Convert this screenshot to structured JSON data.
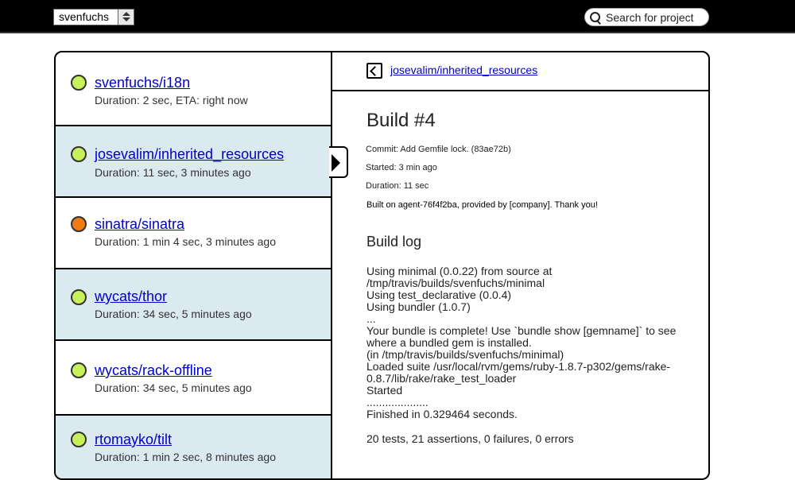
{
  "topbar": {
    "user_select_value": "svenfuchs",
    "search_placeholder": "Search for project"
  },
  "repos": [
    {
      "name": "svenfuchs/i18n",
      "meta": "Duration: 2 sec, ETA: right now",
      "status": "passing",
      "status_color": "#c8f05a"
    },
    {
      "name": "josevalim/inherited_resources",
      "meta": "Duration: 11 sec, 3 minutes ago",
      "status": "passing",
      "status_color": "#c8f05a"
    },
    {
      "name": "sinatra/sinatra",
      "meta": "Duration: 1 min 4 sec, 3 minutes ago",
      "status": "failing",
      "status_color": "#f07a14"
    },
    {
      "name": "wycats/thor",
      "meta": "Duration: 34 sec, 5 minutes ago",
      "status": "passing",
      "status_color": "#c8f05a"
    },
    {
      "name": "wycats/rack-offline",
      "meta": "Duration: 34 sec, 5 minutes ago",
      "status": "passing",
      "status_color": "#c8f05a"
    },
    {
      "name": "rtomayko/tilt",
      "meta": "Duration: 1 min 2 sec, 8 minutes ago",
      "status": "passing",
      "status_color": "#c8f05a"
    }
  ],
  "detail": {
    "repo_link": "josevalim/inherited_resources",
    "build_title": "Build #4",
    "commit": "Commit: Add Gemfile lock. (83ae72b)",
    "started": "Started: 3 min ago",
    "duration": "Duration: 11 sec",
    "built_on": "Built on agent-76f4f2ba, provided by [company]. Thank you!",
    "log_title": "Build log",
    "log_lines": [
      "Using minimal (0.0.22) from source at",
      "/tmp/travis/builds/svenfuchs/minimal",
      "Using test_declarative (0.0.4)",
      "Using bundler (1.0.7)",
      "...",
      "Your bundle is complete! Use `bundle show [gemname]` to see",
      "where a bundled gem is installed.",
      "(in /tmp/travis/builds/svenfuchs/minimal)",
      "Loaded suite /usr/local/rvm/gems/ruby-1.8.7-p302/gems/rake-",
      "0.8.7/lib/rake/rake_test_loader",
      "Started",
      "....................",
      "Finished in 0.329464 seconds."
    ],
    "summary": "20 tests, 21 assertions, 0 failures, 0 errors"
  }
}
